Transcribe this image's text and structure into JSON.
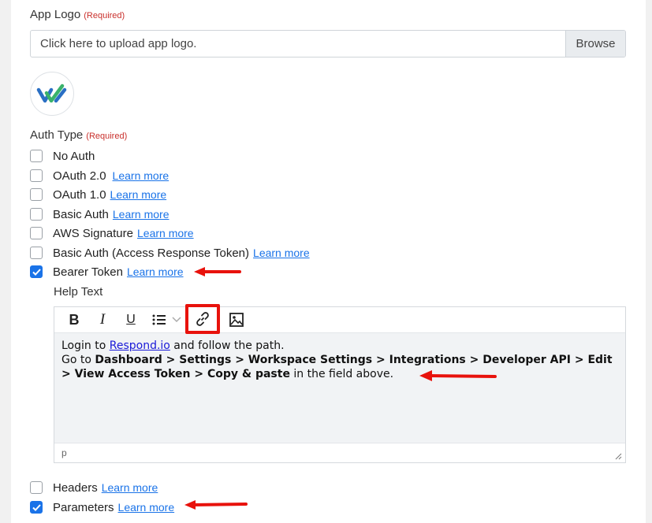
{
  "app_logo": {
    "label": "App Logo",
    "required": "(Required)",
    "upload_placeholder": "Click here to upload app logo.",
    "browse_label": "Browse"
  },
  "auth_type": {
    "label": "Auth Type",
    "required": "(Required)",
    "options": [
      {
        "label": "No Auth",
        "link": "",
        "checked": false
      },
      {
        "label": "OAuth 2.0",
        "link": "Learn more",
        "checked": false
      },
      {
        "label": "OAuth 1.0",
        "link": "Learn more",
        "checked": false
      },
      {
        "label": "Basic Auth",
        "link": "Learn more",
        "checked": false
      },
      {
        "label": "AWS Signature",
        "link": "Learn more",
        "checked": false
      },
      {
        "label": "Basic Auth (Access Response Token)",
        "link": "Learn more",
        "checked": false
      },
      {
        "label": "Bearer Token",
        "link": "Learn more",
        "checked": true
      }
    ]
  },
  "help_text": {
    "label": "Help Text",
    "toolbar_icons": [
      "bold-icon",
      "italic-icon",
      "underline-icon",
      "bullet-list-icon",
      "chevron-down-icon",
      "link-icon",
      "image-icon"
    ],
    "line1_prefix": "Login to ",
    "line1_link": "Respond.io",
    "line1_suffix": " and follow the path.",
    "line2_prefix": "Go to ",
    "line2_bold": "Dashboard > Settings > Workspace Settings > Integrations > Developer API > Edit > View Access Token > Copy & paste",
    "line2_suffix": " in the field above.",
    "status": "p"
  },
  "extra_options": [
    {
      "label": "Headers",
      "link": "Learn more",
      "checked": false
    },
    {
      "label": "Parameters",
      "link": "Learn more",
      "checked": true
    }
  ],
  "colors": {
    "accent": "#1a73e8",
    "required": "#c9302c",
    "annotation": "#e8120c"
  }
}
